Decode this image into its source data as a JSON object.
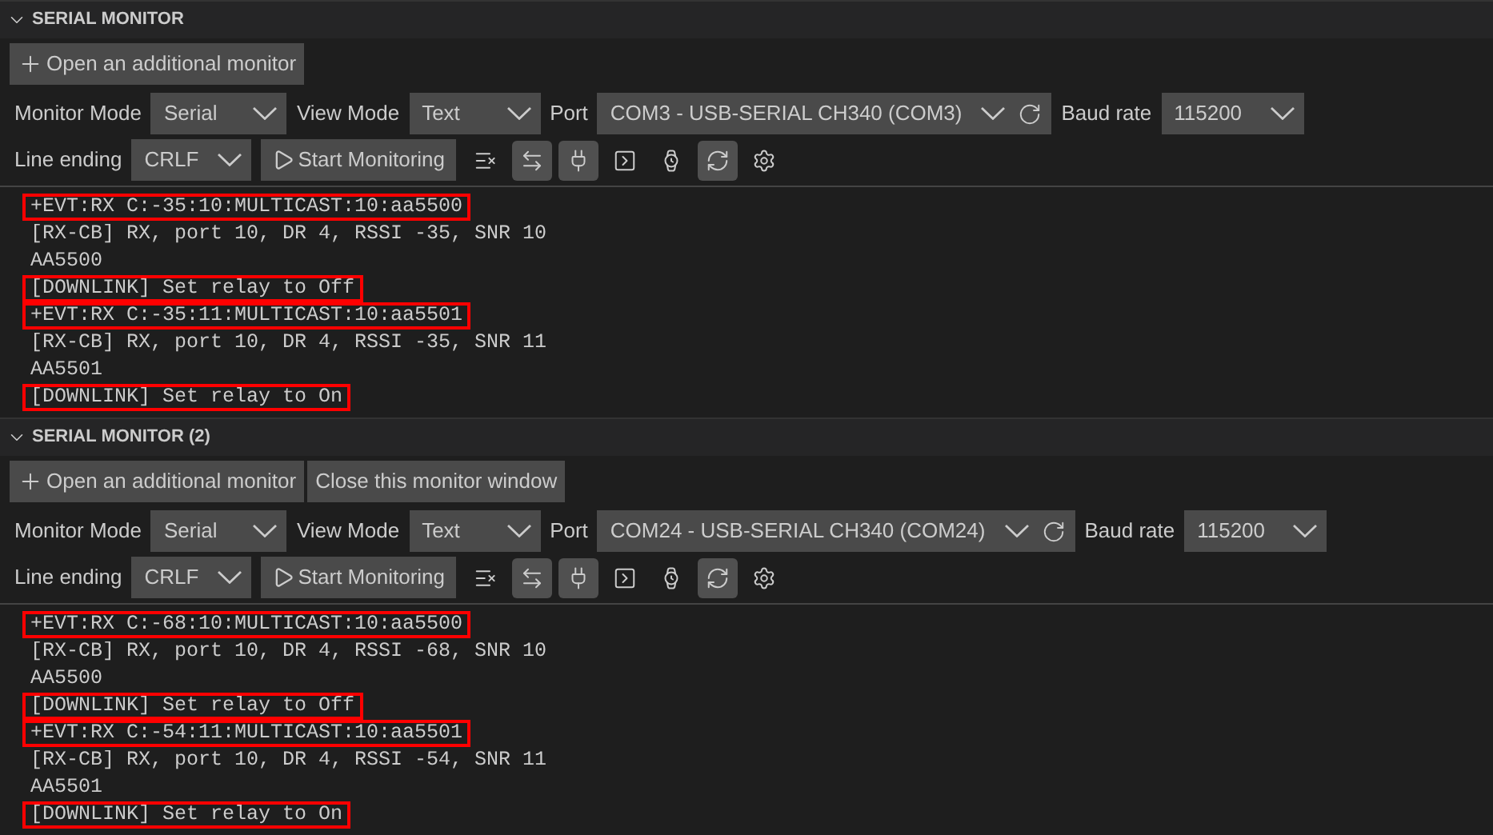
{
  "monitors": [
    {
      "title": "SERIAL MONITOR",
      "buttons": [
        {
          "kind": "add",
          "label": "Open an additional monitor"
        }
      ],
      "fields": [
        {
          "kind": "select",
          "label": "Monitor Mode",
          "value": "Serial"
        },
        {
          "kind": "select",
          "label": "View Mode",
          "value": "Text"
        },
        {
          "kind": "port",
          "label": "Port",
          "value": "COM3 - USB-SERIAL CH340 (COM3)"
        },
        {
          "kind": "select",
          "label": "Baud rate",
          "value": "115200"
        }
      ],
      "line_ending": {
        "label": "Line ending",
        "value": "CRLF"
      },
      "start_button": "Start Monitoring",
      "toolbar": [
        {
          "kind": "clear",
          "on": false
        },
        {
          "kind": "toggle",
          "on": true
        },
        {
          "kind": "plug",
          "on": true
        },
        {
          "kind": "terminal",
          "on": false
        },
        {
          "kind": "watch",
          "on": false
        },
        {
          "kind": "autoscroll",
          "on": true
        },
        {
          "kind": "settings",
          "on": false
        }
      ],
      "lines": [
        {
          "text": "+EVT:RX C:-35:10:MULTICAST:10:aa5500",
          "highlighted": true
        },
        {
          "text": "[RX-CB] RX, port 10, DR 4, RSSI -35, SNR 10",
          "highlighted": false
        },
        {
          "text": "AA5500",
          "highlighted": false
        },
        {
          "text": "[DOWNLINK] Set relay to Off",
          "highlighted": true
        },
        {
          "text": "+EVT:RX C:-35:11:MULTICAST:10:aa5501",
          "highlighted": true
        },
        {
          "text": "[RX-CB] RX, port 10, DR 4, RSSI -35, SNR 11",
          "highlighted": false
        },
        {
          "text": "AA5501",
          "highlighted": false
        },
        {
          "text": "[DOWNLINK] Set relay to On",
          "highlighted": true
        }
      ]
    },
    {
      "title": "SERIAL MONITOR (2)",
      "buttons": [
        {
          "kind": "add",
          "label": "Open an additional monitor"
        },
        {
          "kind": "close",
          "label": "Close this monitor window"
        }
      ],
      "fields": [
        {
          "kind": "select",
          "label": "Monitor Mode",
          "value": "Serial"
        },
        {
          "kind": "select",
          "label": "View Mode",
          "value": "Text"
        },
        {
          "kind": "port",
          "label": "Port",
          "value": "COM24 - USB-SERIAL CH340 (COM24)"
        },
        {
          "kind": "select",
          "label": "Baud rate",
          "value": "115200"
        }
      ],
      "line_ending": {
        "label": "Line ending",
        "value": "CRLF"
      },
      "start_button": "Start Monitoring",
      "toolbar": [
        {
          "kind": "clear",
          "on": false
        },
        {
          "kind": "toggle",
          "on": true
        },
        {
          "kind": "plug",
          "on": true
        },
        {
          "kind": "terminal",
          "on": false
        },
        {
          "kind": "watch",
          "on": false
        },
        {
          "kind": "autoscroll",
          "on": true
        },
        {
          "kind": "settings",
          "on": false
        }
      ],
      "lines": [
        {
          "text": "+EVT:RX C:-68:10:MULTICAST:10:aa5500",
          "highlighted": true
        },
        {
          "text": "[RX-CB] RX, port 10, DR 4, RSSI -68, SNR 10",
          "highlighted": false
        },
        {
          "text": "AA5500",
          "highlighted": false
        },
        {
          "text": "[DOWNLINK] Set relay to Off",
          "highlighted": true
        },
        {
          "text": "+EVT:RX C:-54:11:MULTICAST:10:aa5501",
          "highlighted": true
        },
        {
          "text": "[RX-CB] RX, port 10, DR 4, RSSI -54, SNR 11",
          "highlighted": false
        },
        {
          "text": "AA5501",
          "highlighted": false
        },
        {
          "text": "[DOWNLINK] Set relay to On",
          "highlighted": true
        }
      ]
    }
  ]
}
